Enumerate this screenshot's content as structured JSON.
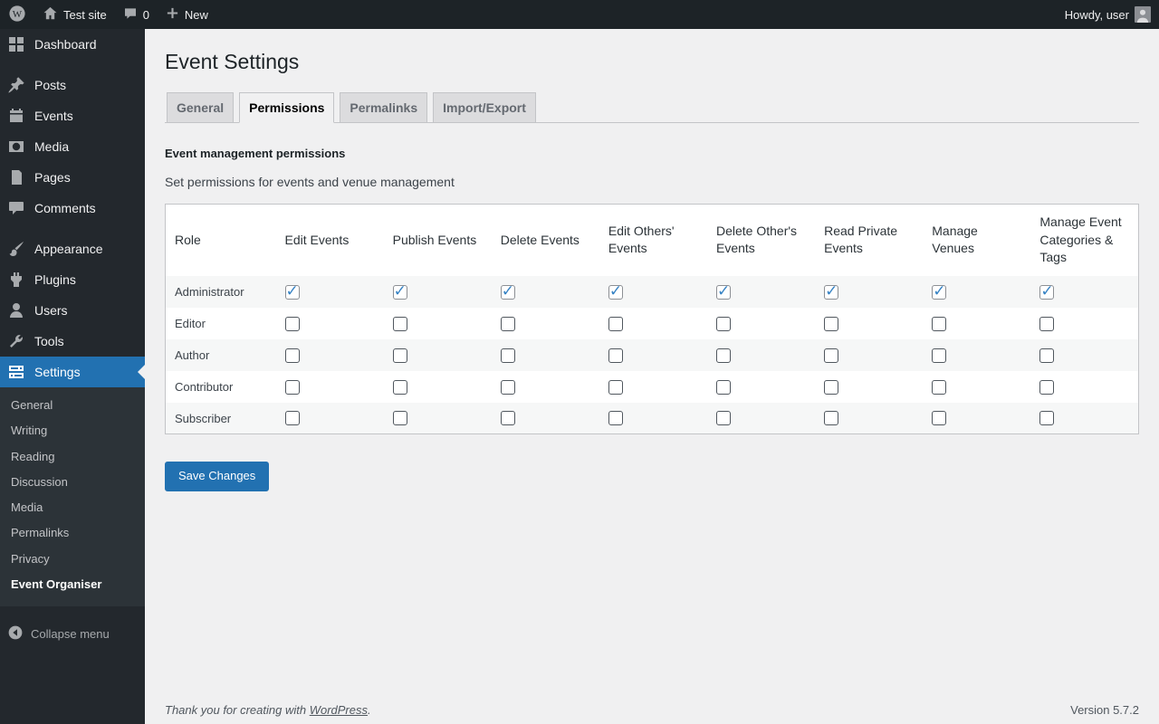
{
  "admin_bar": {
    "site_name": "Test site",
    "comments_count": "0",
    "new_label": "New",
    "howdy": "Howdy, user"
  },
  "sidebar": {
    "items": [
      {
        "label": "Dashboard",
        "icon": "dashboard-icon",
        "active": false,
        "separator_before": false
      },
      {
        "label": "Posts",
        "icon": "pin-icon",
        "active": false,
        "separator_before": true
      },
      {
        "label": "Events",
        "icon": "calendar-icon",
        "active": false,
        "separator_before": false
      },
      {
        "label": "Media",
        "icon": "media-icon",
        "active": false,
        "separator_before": false
      },
      {
        "label": "Pages",
        "icon": "pages-icon",
        "active": false,
        "separator_before": false
      },
      {
        "label": "Comments",
        "icon": "comments-icon",
        "active": false,
        "separator_before": false
      },
      {
        "label": "Appearance",
        "icon": "appearance-icon",
        "active": false,
        "separator_before": true
      },
      {
        "label": "Plugins",
        "icon": "plugins-icon",
        "active": false,
        "separator_before": false
      },
      {
        "label": "Users",
        "icon": "users-icon",
        "active": false,
        "separator_before": false
      },
      {
        "label": "Tools",
        "icon": "tools-icon",
        "active": false,
        "separator_before": false
      },
      {
        "label": "Settings",
        "icon": "settings-icon",
        "active": true,
        "separator_before": false
      }
    ],
    "settings_submenu": [
      "General",
      "Writing",
      "Reading",
      "Discussion",
      "Media",
      "Permalinks",
      "Privacy",
      "Event Organiser"
    ],
    "submenu_current": "Event Organiser",
    "collapse_label": "Collapse menu"
  },
  "main": {
    "page_title": "Event Settings",
    "tabs": [
      {
        "label": "General",
        "active": false
      },
      {
        "label": "Permissions",
        "active": true
      },
      {
        "label": "Permalinks",
        "active": false
      },
      {
        "label": "Import/Export",
        "active": false
      }
    ],
    "section_heading": "Event management permissions",
    "section_description": "Set permissions for events and venue management",
    "table": {
      "headers": [
        "Role",
        "Edit Events",
        "Publish Events",
        "Delete Events",
        "Edit Others' Events",
        "Delete Other's Events",
        "Read Private Events",
        "Manage Venues",
        "Manage Event Categories & Tags"
      ],
      "rows": [
        {
          "role": "Administrator",
          "permissions": [
            true,
            true,
            true,
            true,
            true,
            true,
            true,
            true
          ]
        },
        {
          "role": "Editor",
          "permissions": [
            false,
            false,
            false,
            false,
            false,
            false,
            false,
            false
          ]
        },
        {
          "role": "Author",
          "permissions": [
            false,
            false,
            false,
            false,
            false,
            false,
            false,
            false
          ]
        },
        {
          "role": "Contributor",
          "permissions": [
            false,
            false,
            false,
            false,
            false,
            false,
            false,
            false
          ]
        },
        {
          "role": "Subscriber",
          "permissions": [
            false,
            false,
            false,
            false,
            false,
            false,
            false,
            false
          ]
        }
      ]
    },
    "save_button": "Save Changes"
  },
  "footer": {
    "thanks_prefix": "Thank you for creating with ",
    "wordpress_link": "WordPress",
    "thanks_suffix": ".",
    "version": "Version 5.7.2"
  }
}
